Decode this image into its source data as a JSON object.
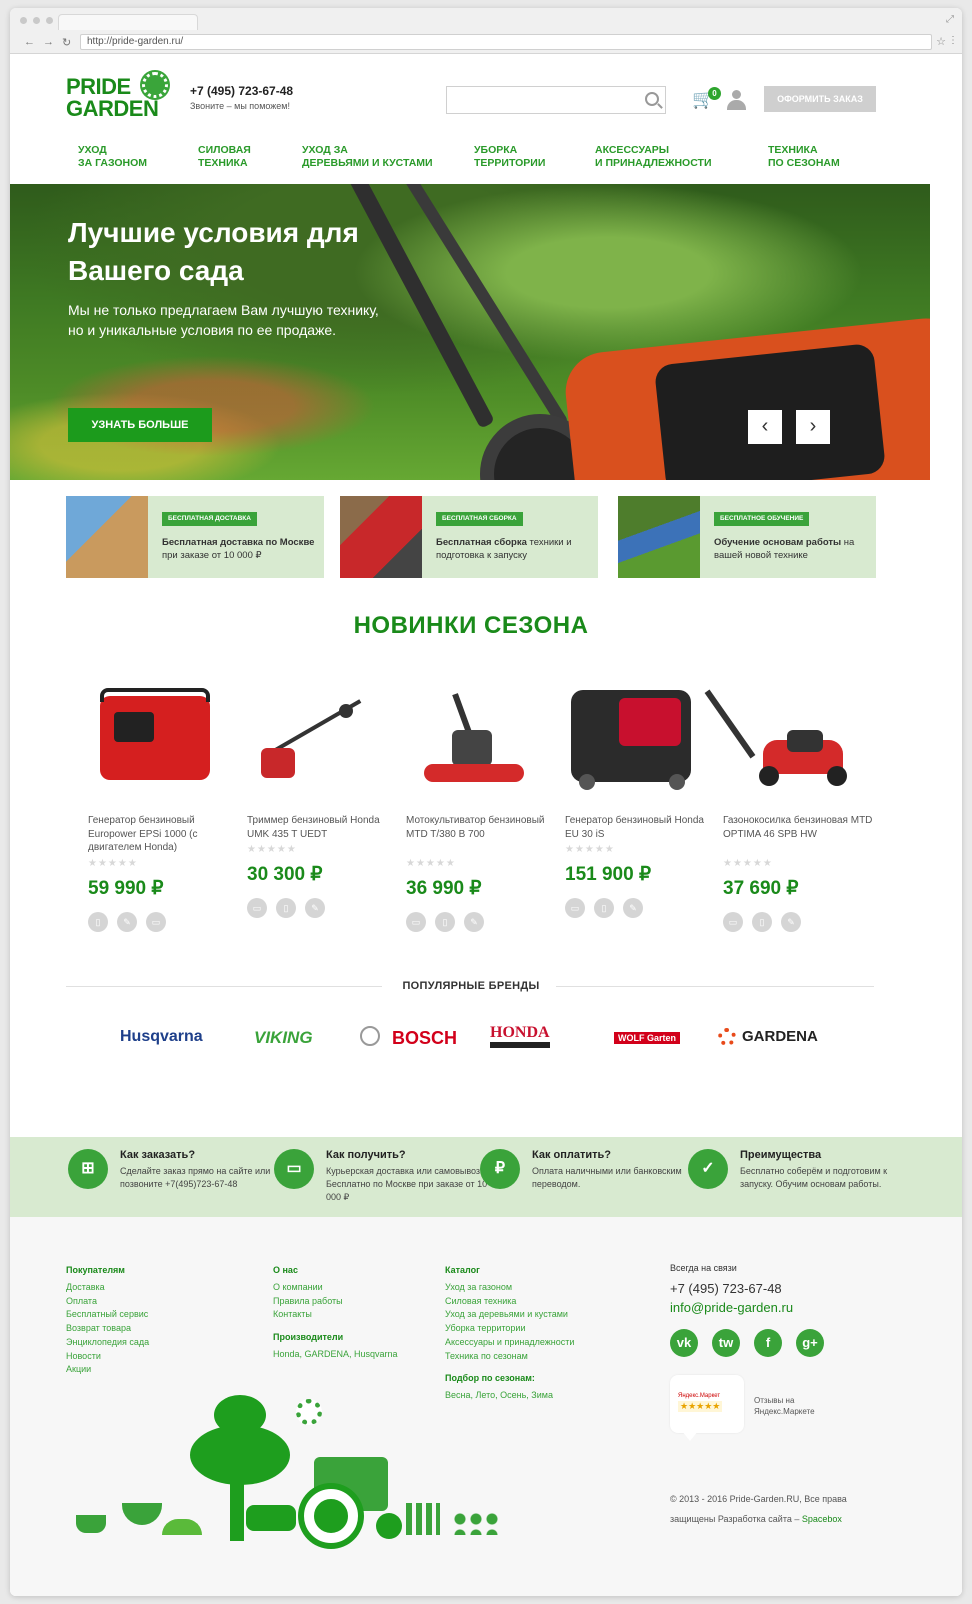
{
  "browser": {
    "url": "http://pride-garden.ru/"
  },
  "header": {
    "logo_line1": "PRIDE",
    "logo_line2": "GARDEN",
    "phone": "+7 (495) 723-67-48",
    "phone_sub": "Звоните – мы поможем!",
    "cart_count": "0",
    "order_button": "ОФОРМИТЬ ЗАКАЗ"
  },
  "nav": [
    {
      "label": "УХОД\nЗА ГАЗОНОМ"
    },
    {
      "label": "СИЛОВАЯ\nТЕХНИКА"
    },
    {
      "label": "УХОД ЗА\nДЕРЕВЬЯМИ И КУСТАМИ"
    },
    {
      "label": "УБОРКА\nТЕРРИТОРИИ"
    },
    {
      "label": "АКСЕССУАРЫ\nИ ПРИНАДЛЕЖНОСТИ"
    },
    {
      "label": "ТЕХНИКА\nПО СЕЗОНАМ"
    }
  ],
  "hero": {
    "title": "Лучшие условия для Вашего сада",
    "text": "Мы не только предлагаем Вам лучшую технику, но и уникальные условия по ее продаже.",
    "button": "УЗНАТЬ БОЛЬШЕ",
    "prev": "‹",
    "next": "›"
  },
  "features": [
    {
      "badge": "БЕСПЛАТНАЯ ДОСТАВКА",
      "bold": "Бесплатная доставка по Москве",
      "text": " при заказе от 10 000 ₽"
    },
    {
      "badge": "БЕСПЛАТНАЯ СБОРКА",
      "bold": "Бесплатная сборка",
      "text": " техники и подготовка к запуску"
    },
    {
      "badge": "БЕСПЛАТНОЕ ОБУЧЕНИЕ",
      "bold": "Обучение основам работы",
      "text": " на вашей новой технике"
    }
  ],
  "new_section_title": "НОВИНКИ СЕЗОНА",
  "products": [
    {
      "name": "Генератор бензиновый Europower EPSi 1000 (с двигателем Honda)",
      "price": "59 990 ₽",
      "rating": 0
    },
    {
      "name": "Триммер бензиновый Honda UMK 435 T UEDT",
      "price": "30 300 ₽",
      "rating": 0
    },
    {
      "name": "Мотокультиватор бензиновый MTD T/380 B 700",
      "price": "36 990 ₽",
      "rating": 0
    },
    {
      "name": "Генератор бензиновый Honda EU 30 iS",
      "price": "151 900 ₽",
      "rating": 0
    },
    {
      "name": "Газонокосилка бензиновая MTD OPTIMA 46 SPB HW",
      "price": "37 690 ₽",
      "rating": 0
    }
  ],
  "brands_title": "ПОПУЛЯРНЫЕ БРЕНДЫ",
  "brands": [
    {
      "name": "Husqvarna",
      "color": "#1e3f8a"
    },
    {
      "name": "VIKING",
      "color": "#3aa33a"
    },
    {
      "name": "BOSCH",
      "color": "#d2001a"
    },
    {
      "name": "HONDA",
      "color": "#c8102e"
    },
    {
      "name": "WOLF Garten",
      "color": "#ffffff"
    },
    {
      "name": "GARDENA",
      "color": "#222222"
    }
  ],
  "info": [
    {
      "icon": "cart-icon",
      "title": "Как заказать?",
      "text": "Сделайте заказ прямо на сайте или позвоните +7(495)723-67-48"
    },
    {
      "icon": "truck-icon",
      "title": "Как получить?",
      "text": "Курьерская доставка или самовывоз. Бесплатно по Москве при заказе от 10 000 ₽"
    },
    {
      "icon": "ruble-icon",
      "title": "Как оплатить?",
      "text": "Оплата наличными или банковским переводом."
    },
    {
      "icon": "thumbs-up-icon",
      "title": "Преимущества",
      "text": "Бесплатно соберём и подготовим к запуску. Обучим основам работы."
    }
  ],
  "footer": {
    "buyers": {
      "title": "Покупателям",
      "links": [
        "Доставка",
        "Оплата",
        "Бесплатный сервис",
        "Возврат товара",
        "Энциклопедия сада",
        "Новости",
        "Акции"
      ]
    },
    "about": {
      "title": "О нас",
      "links": [
        "О компании",
        "Правила работы",
        "Контакты"
      ],
      "makers_title": "Производители",
      "makers": "Honda, GARDENA, Husqvarna"
    },
    "catalog": {
      "title": "Каталог",
      "links": [
        "Уход за газоном",
        "Силовая техника",
        "Уход за деревьями и кустами",
        "Уборка территории",
        "Аксессуары и принадлежности",
        "Техника по сезонам"
      ],
      "seasons_title": "Подбор по сезонам:",
      "seasons": "Весна, Лето, Осень, Зима"
    },
    "contact": {
      "label": "Всегда на связи",
      "phone": "+7 (495) 723-67-48",
      "email": "info@pride-garden.ru"
    },
    "social": [
      "vk",
      "tw",
      "f",
      "g+"
    ],
    "ymarket_label": "Яндекс.Маркет",
    "ymarket_stars": "★★★★★",
    "ymarket_review": "Отзывы на Яндекс.Маркете",
    "copyright_text": "© 2013 - 2016 Pride-Garden.RU, Все права защищены Разработка сайта – ",
    "copyright_link": "Spacebox"
  },
  "colors": {
    "brand_green": "#1a8a1a",
    "accent_green": "#3aa33a",
    "light_green_bg": "#d8ead0",
    "button_grey": "#cfcfcf"
  }
}
